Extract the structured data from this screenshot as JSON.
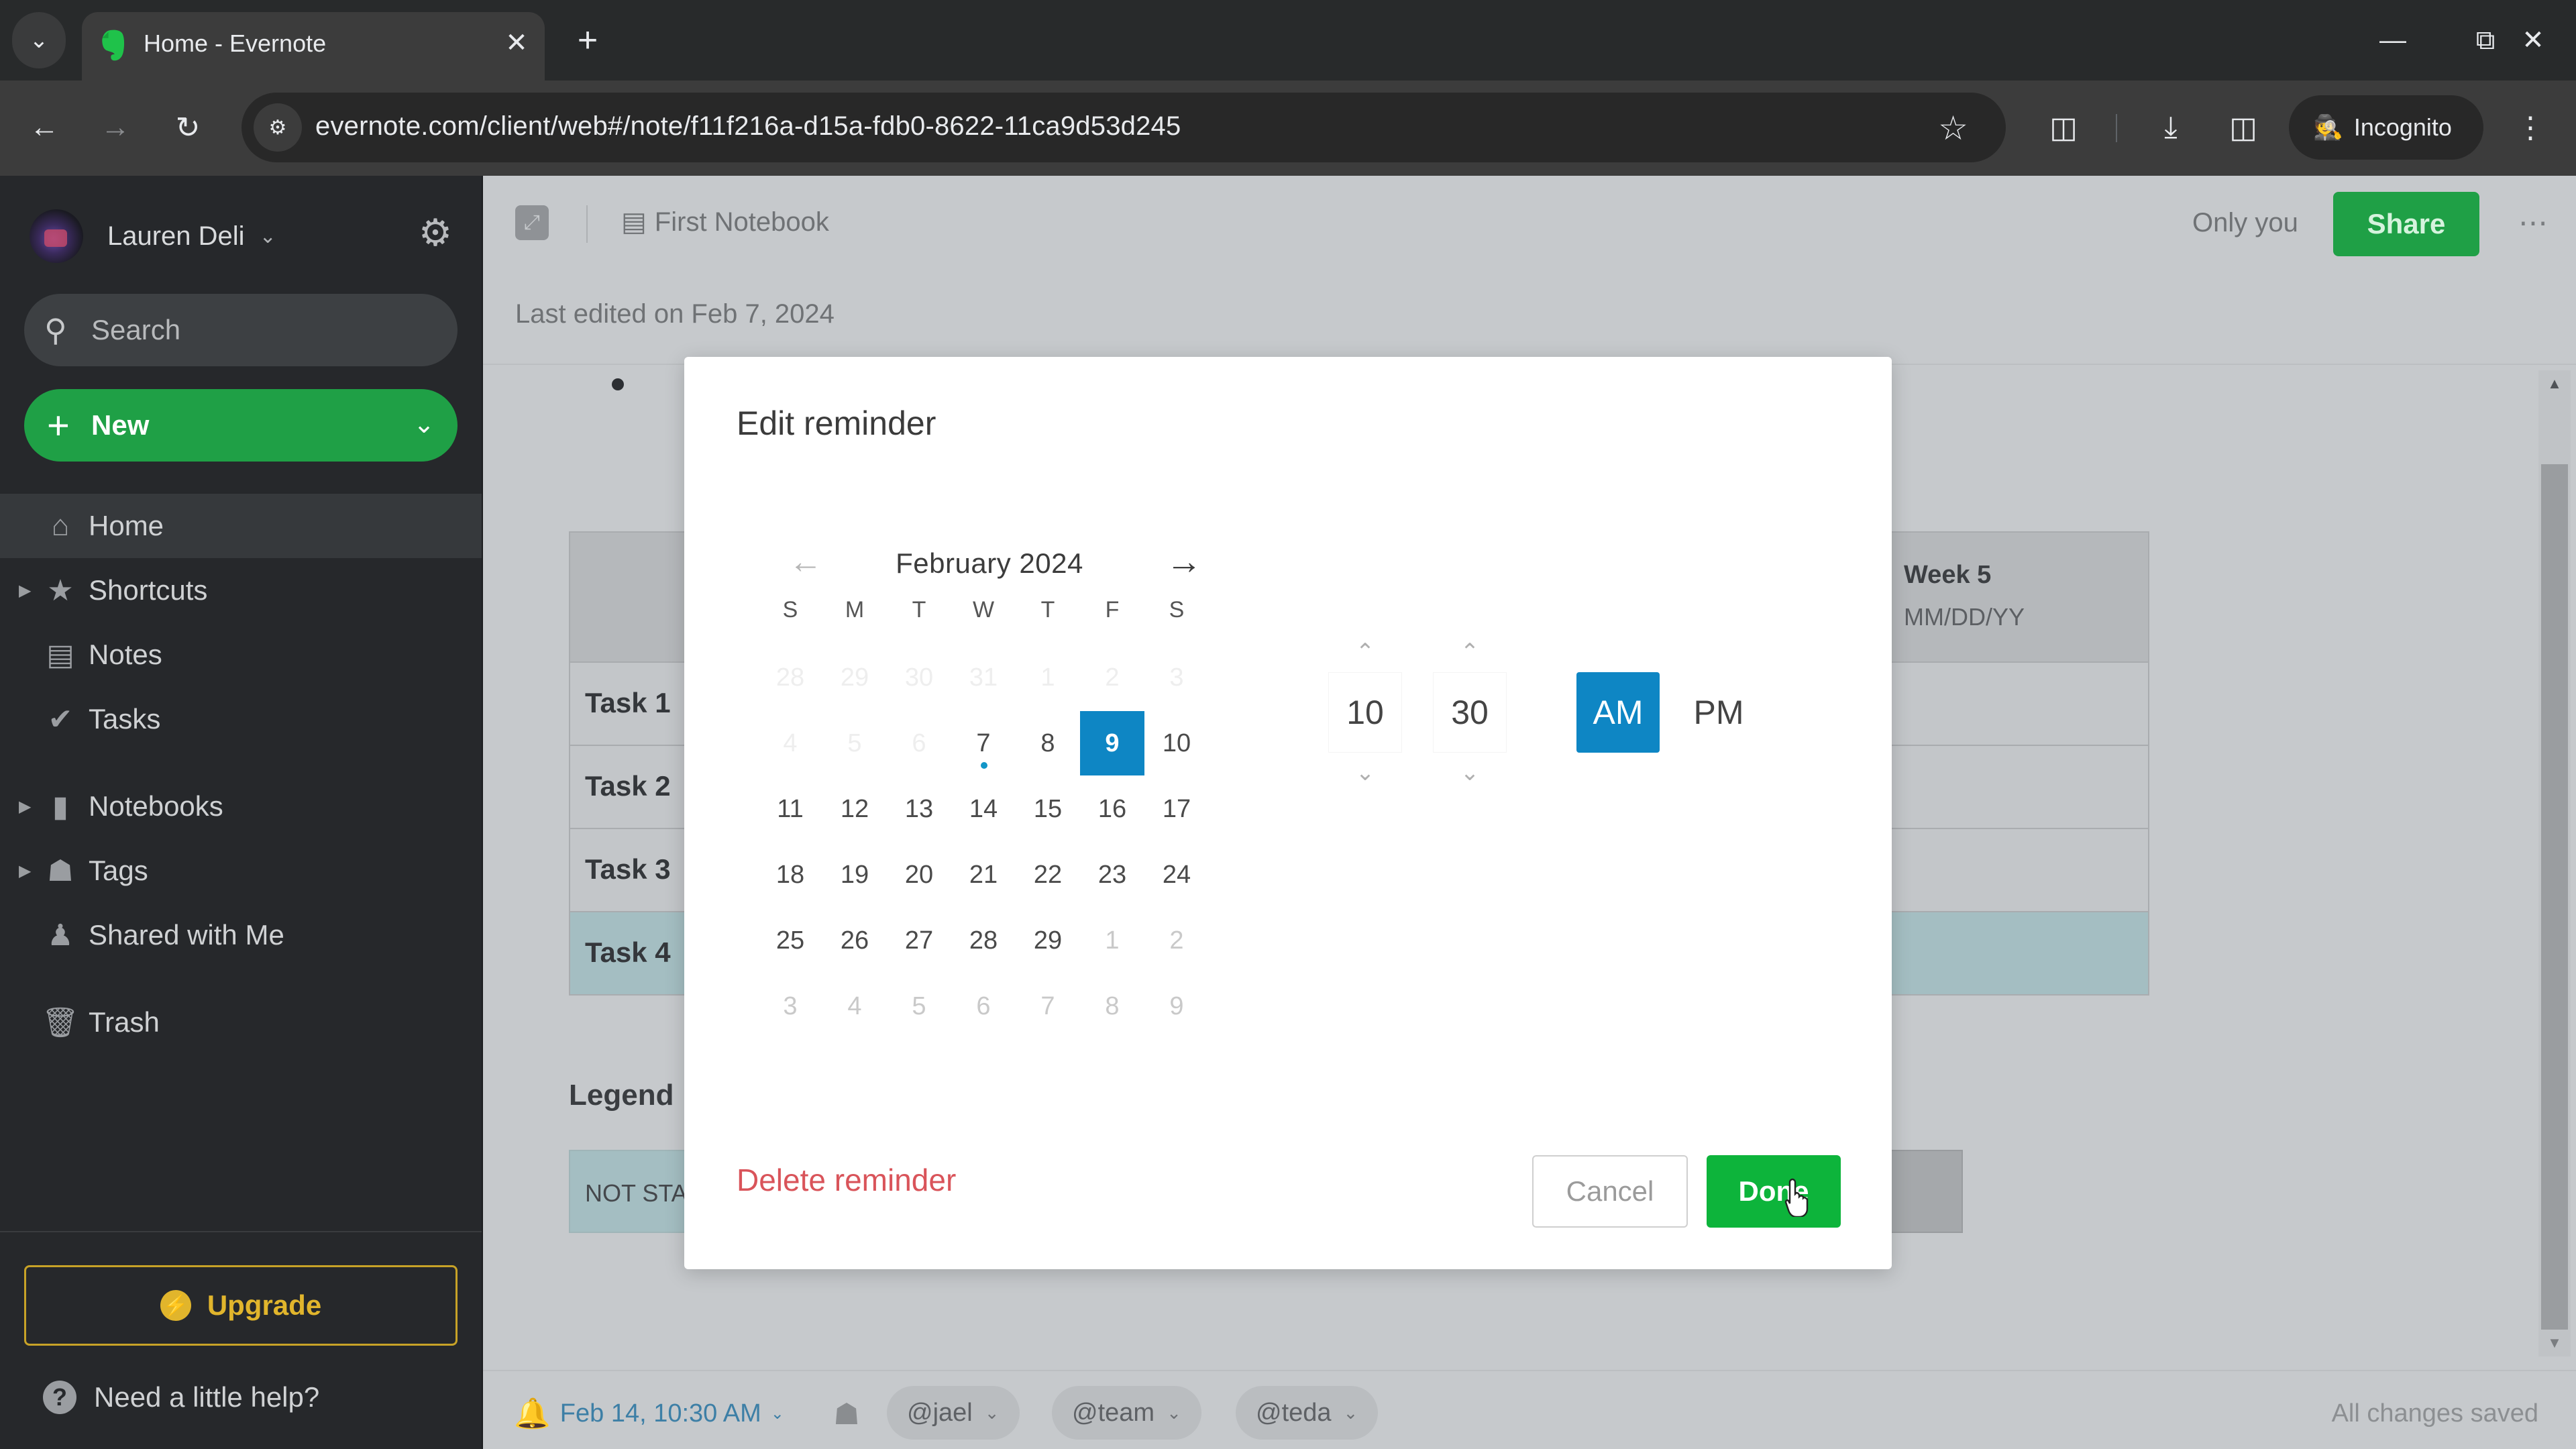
{
  "browser": {
    "tab_title": "Home - Evernote",
    "url": "evernote.com/client/web#/note/f11f216a-d15a-fdb0-8622-11ca9d53d245",
    "incognito_label": "Incognito",
    "icons": {
      "tab_search": "chevron-down-icon",
      "tab_close": "close-icon",
      "new_tab": "plus-icon",
      "minimize": "minimize-icon",
      "restore": "restore-icon",
      "close_window": "close-icon",
      "back": "arrow-left-icon",
      "forward": "arrow-right-icon",
      "reload": "reload-icon",
      "site_info": "tune-icon",
      "bookmark": "star-icon",
      "extensions": "puzzle-icon",
      "downloads": "download-icon",
      "side_panel": "side-panel-icon",
      "menu": "more-vert-icon"
    }
  },
  "sidebar": {
    "user_name": "Lauren Deli",
    "search_placeholder": "Search",
    "new_label": "New",
    "items": [
      {
        "label": "Home",
        "icon": "home-icon",
        "active": true,
        "expandable": false
      },
      {
        "label": "Shortcuts",
        "icon": "star-icon",
        "active": false,
        "expandable": true
      },
      {
        "label": "Notes",
        "icon": "note-icon",
        "active": false,
        "expandable": false
      },
      {
        "label": "Tasks",
        "icon": "check-circle-icon",
        "active": false,
        "expandable": false
      },
      {
        "label": "Notebooks",
        "icon": "notebook-icon",
        "active": false,
        "expandable": true
      },
      {
        "label": "Tags",
        "icon": "tag-icon",
        "active": false,
        "expandable": true
      },
      {
        "label": "Shared with Me",
        "icon": "people-icon",
        "active": false,
        "expandable": false
      },
      {
        "label": "Trash",
        "icon": "trash-icon",
        "active": false,
        "expandable": false
      }
    ],
    "upgrade_label": "Upgrade",
    "help_label": "Need a little help?"
  },
  "note": {
    "notebook": "First Notebook",
    "visibility": "Only you",
    "share_label": "Share",
    "more_label": "⋯",
    "last_edited": "Last edited on Feb 7, 2024",
    "table": {
      "tasks": [
        "Task 1",
        "Task 2",
        "Task 3",
        "Task 4"
      ],
      "visible_column": {
        "title": "Week 5",
        "date": "MM/DD/YY"
      }
    },
    "legend_title": "Legend",
    "legend_items": [
      "NOT STA"
    ],
    "footer": {
      "reminder": "Feb 14, 10:30 AM",
      "mentions": [
        "@jael",
        "@team",
        "@teda"
      ],
      "status": "All changes saved"
    }
  },
  "modal": {
    "title": "Edit reminder",
    "calendar": {
      "month_label": "February 2024",
      "weekdays": [
        "S",
        "M",
        "T",
        "W",
        "T",
        "F",
        "S"
      ],
      "weeks": [
        [
          {
            "d": "28",
            "s": "faint"
          },
          {
            "d": "29",
            "s": "faint"
          },
          {
            "d": "30",
            "s": "faint"
          },
          {
            "d": "31",
            "s": "faint"
          },
          {
            "d": "1",
            "s": "faint"
          },
          {
            "d": "2",
            "s": "faint"
          },
          {
            "d": "3",
            "s": "faint"
          }
        ],
        [
          {
            "d": "4",
            "s": "faint"
          },
          {
            "d": "5",
            "s": "faint"
          },
          {
            "d": "6",
            "s": "faint"
          },
          {
            "d": "7",
            "s": "today"
          },
          {
            "d": "8",
            "s": "normal"
          },
          {
            "d": "9",
            "s": "selected"
          },
          {
            "d": "10",
            "s": "normal"
          }
        ],
        [
          {
            "d": "11",
            "s": "normal"
          },
          {
            "d": "12",
            "s": "normal"
          },
          {
            "d": "13",
            "s": "normal"
          },
          {
            "d": "14",
            "s": "normal"
          },
          {
            "d": "15",
            "s": "normal"
          },
          {
            "d": "16",
            "s": "normal"
          },
          {
            "d": "17",
            "s": "normal"
          }
        ],
        [
          {
            "d": "18",
            "s": "normal"
          },
          {
            "d": "19",
            "s": "normal"
          },
          {
            "d": "20",
            "s": "normal"
          },
          {
            "d": "21",
            "s": "normal"
          },
          {
            "d": "22",
            "s": "normal"
          },
          {
            "d": "23",
            "s": "normal"
          },
          {
            "d": "24",
            "s": "normal"
          }
        ],
        [
          {
            "d": "25",
            "s": "normal"
          },
          {
            "d": "26",
            "s": "normal"
          },
          {
            "d": "27",
            "s": "normal"
          },
          {
            "d": "28",
            "s": "normal"
          },
          {
            "d": "29",
            "s": "normal"
          },
          {
            "d": "1",
            "s": "muted"
          },
          {
            "d": "2",
            "s": "muted"
          }
        ],
        [
          {
            "d": "3",
            "s": "muted"
          },
          {
            "d": "4",
            "s": "muted"
          },
          {
            "d": "5",
            "s": "muted"
          },
          {
            "d": "6",
            "s": "muted"
          },
          {
            "d": "7",
            "s": "muted"
          },
          {
            "d": "8",
            "s": "muted"
          },
          {
            "d": "9",
            "s": "muted"
          }
        ]
      ]
    },
    "time": {
      "hour": "10",
      "minute": "30",
      "am_label": "AM",
      "pm_label": "PM",
      "period": "AM"
    },
    "delete_label": "Delete reminder",
    "cancel_label": "Cancel",
    "done_label": "Done"
  },
  "colors": {
    "brand_green": "#1fa046",
    "done_green": "#0db43b",
    "accent_blue": "#0e86c4",
    "danger_red": "#d9545a",
    "upgrade_gold": "#e1b52c"
  }
}
